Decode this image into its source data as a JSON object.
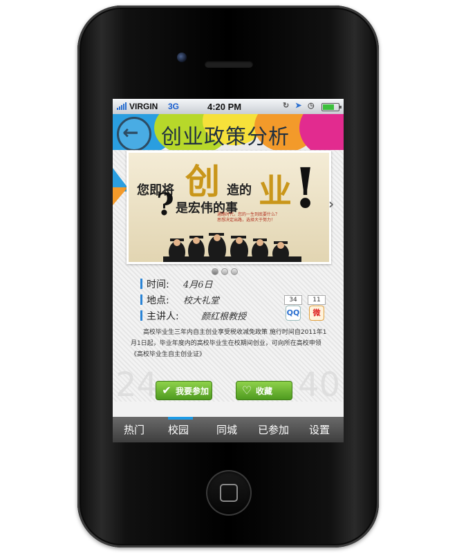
{
  "status_bar": {
    "carrier": "VIRGIN",
    "network": "3G",
    "time": "4:20 PM"
  },
  "header": {
    "title": "创业政策分析"
  },
  "banner": {
    "line1": "您即将",
    "big1": "创",
    "line1b": "造的",
    "big2": "业",
    "exclaim": "!",
    "line2": "是宏伟的事",
    "question": "?",
    "small_text": "通路时代，您的一生到底要什么？思想决定出路，选择大于努力！"
  },
  "carousel": {
    "pages": 3,
    "active": 0
  },
  "event": {
    "time_label": "时间:",
    "time_value": "4月6日",
    "place_label": "地点:",
    "place_value": "校大礼堂",
    "speaker_label": "主讲人:",
    "speaker_value": "颜红根教授"
  },
  "share": {
    "count1": "34",
    "count2": "11"
  },
  "description": "高校毕业生三年内自主创业享受税收减免政策 施行时间自2011年1月1日起，毕业年度内的高校毕业生在校期间创业，可向所在高校申领《高校毕业生自主创业证》",
  "stats": {
    "left": "24",
    "right": "40"
  },
  "actions": {
    "join_label": "我要参加",
    "fav_label": "收藏"
  },
  "tabs": [
    {
      "label": "热门"
    },
    {
      "label": "校园"
    },
    {
      "label": "同城"
    },
    {
      "label": "已参加"
    },
    {
      "label": "设置"
    }
  ],
  "colors": {
    "accent_blue": "#1e9be6",
    "button_green": "#6bb832",
    "gold": "#c9961a"
  }
}
